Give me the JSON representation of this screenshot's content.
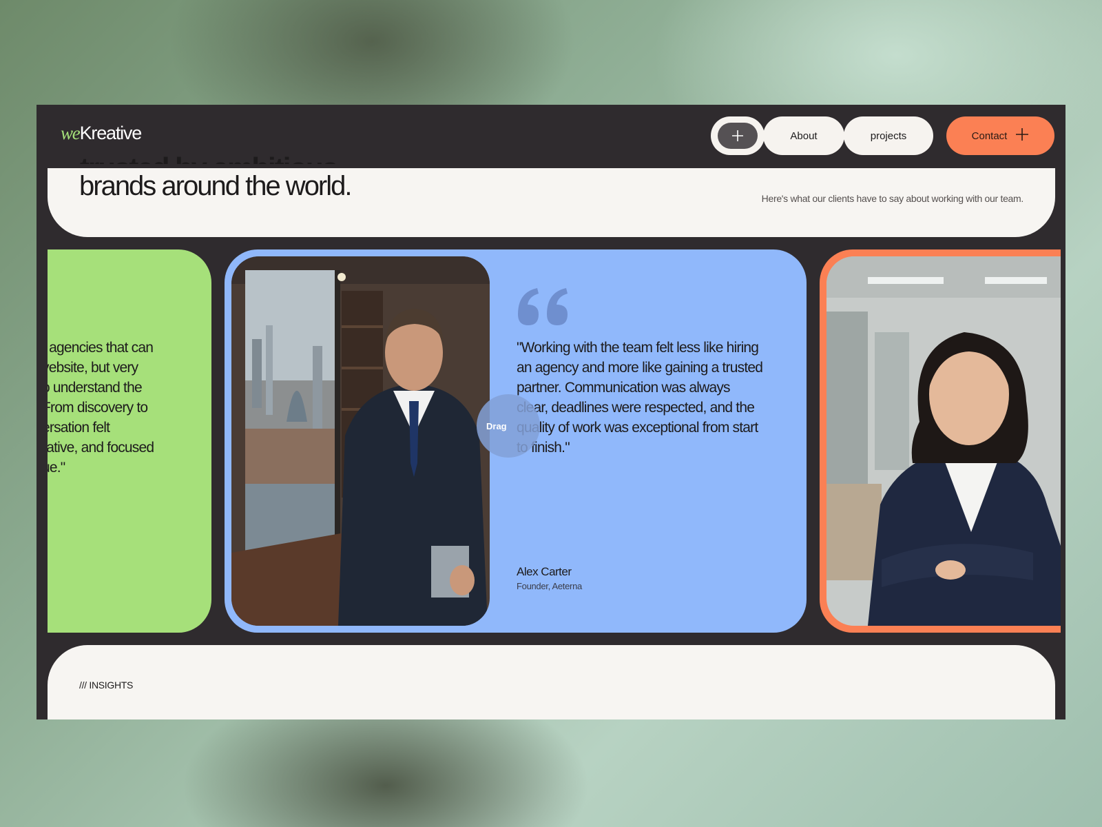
{
  "nav": {
    "logo_prefix": "we",
    "logo_main": "Kreative",
    "plus_icon": "plus-icon",
    "about_label": "About",
    "projects_label": "projects",
    "contact_label": "Contact",
    "contact_icon": "plus-icon"
  },
  "hero": {
    "line_cut": "trusted by ambitious",
    "line_2": "brands around the world.",
    "subtitle": "Here's what our clients have to say about working with our team."
  },
  "testimonials": {
    "previous_quote_lines": [
      "f agencies that can",
      "vebsite, but very",
      "o understand the",
      "From discovery to",
      "ersation felt",
      "rative, and focused",
      "ue.\""
    ],
    "current": {
      "quote": "\"Working with the team felt less like hiring an agency and more like gaining a trusted partner. Communication was always clear, deadlines were respected, and the quality of work was exceptional from start to finish.\"",
      "name": "Alex Carter",
      "role": "Founder, Aeterna"
    },
    "drag_label": "Drag",
    "quote_icon": "quote-icon"
  },
  "insights": {
    "label": "/// INSIGHTS"
  },
  "colors": {
    "dark": "#2f2b2e",
    "cream": "#f7f5f2",
    "green": "#a6e07a",
    "blue": "#90b8fb",
    "orange": "#fb8054"
  }
}
